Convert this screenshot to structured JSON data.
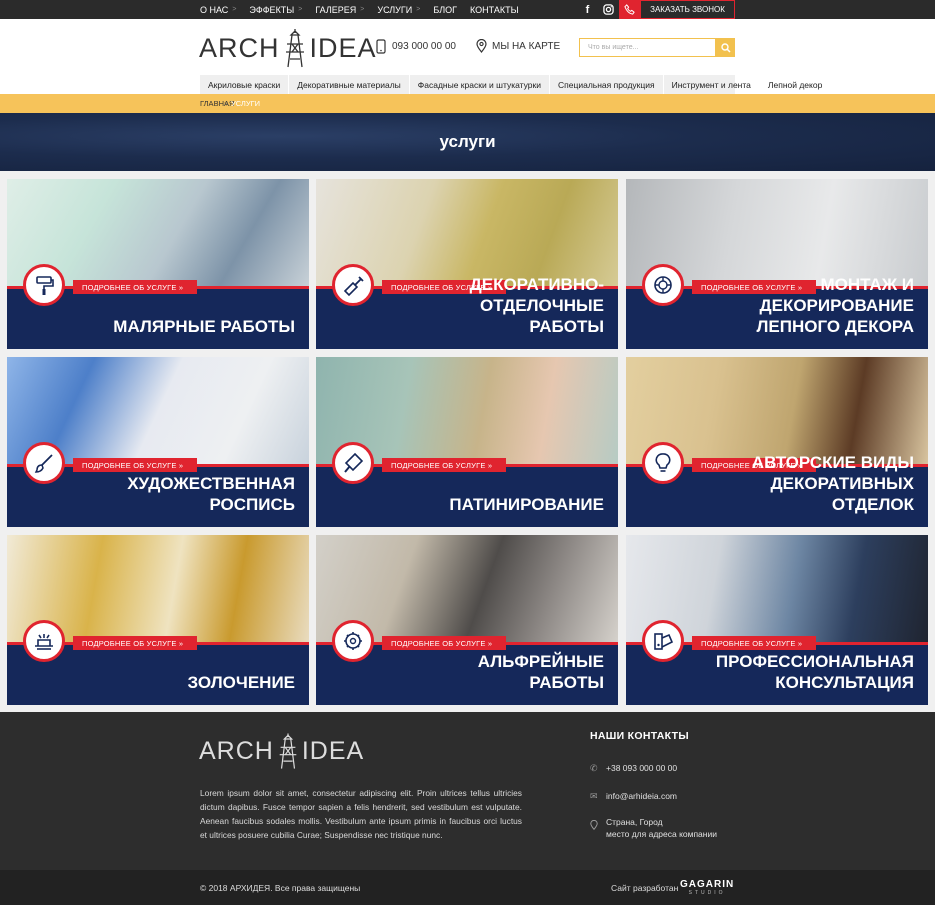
{
  "topbar": {
    "nav": [
      {
        "label": "О НАС",
        "has_sub": true
      },
      {
        "label": "ЭФФЕКТЫ",
        "has_sub": true
      },
      {
        "label": "ГАЛЕРЕЯ",
        "has_sub": true
      },
      {
        "label": "УСЛУГИ",
        "has_sub": true
      },
      {
        "label": "БЛОГ",
        "has_sub": false
      },
      {
        "label": "КОНТАКТЫ",
        "has_sub": false
      }
    ],
    "social": {
      "facebook": "f",
      "instagram": "instagram-icon",
      "phone": "phone-icon"
    },
    "call_button": "ЗАКАЗАТЬ ЗВОНОК"
  },
  "header": {
    "logo_left": "ARCH",
    "logo_right": "IDEA",
    "phone": "093 000 00 00",
    "map": "МЫ НА КАРТЕ",
    "search_placeholder": "Что вы ищете...",
    "categories": [
      "Акриловые краски",
      "Декоративные материалы",
      "Фасадные краски и штукатурки",
      "Специальная продукция",
      "Инструмент и лента",
      "Лепной декор"
    ]
  },
  "breadcrumb": {
    "home": "ГЛАВНАЯ",
    "separator": "»",
    "current": "УСЛУГИ"
  },
  "banner": {
    "title": "услуги"
  },
  "services": [
    {
      "title_lines": [
        "МАЛЯРНЫЕ РАБОТЫ"
      ],
      "more": "ПОДРОБНЕЕ ОБ УСЛУГЕ »",
      "icon": "paint-roller-icon"
    },
    {
      "title_lines": [
        "ДЕКОРАТИВНО-ОТДЕЛОЧНЫЕ",
        "РАБОТЫ"
      ],
      "more": "ПОДРОБНЕЕ ОБ УСЛУГЕ »",
      "icon": "trowel-icon"
    },
    {
      "title_lines": [
        "МОНТАЖ И ДЕКОРИРОВАНИЕ",
        "ЛЕПНОГО ДЕКОРА"
      ],
      "more": "ПОДРОБНЕЕ ОБ УСЛУГЕ »",
      "icon": "ornament-icon"
    },
    {
      "title_lines": [
        "ХУДОЖЕСТВЕННАЯ",
        "РОСПИСЬ"
      ],
      "more": "ПОДРОБНЕЕ ОБ УСЛУГЕ »",
      "icon": "brush-icon"
    },
    {
      "title_lines": [
        "ПАТИНИРОВАНИЕ"
      ],
      "more": "ПОДРОБНЕЕ ОБ УСЛУГЕ »",
      "icon": "paint-pot-icon"
    },
    {
      "title_lines": [
        "АВТОРСКИЕ ВИДЫ",
        "ДЕКОРАТИВНЫХ ОТДЕЛОК"
      ],
      "more": "ПОДРОБНЕЕ ОБ УСЛУГЕ »",
      "icon": "lightbulb-icon"
    },
    {
      "title_lines": [
        "ЗОЛОЧЕНИЕ"
      ],
      "more": "ПОДРОБНЕЕ ОБ УСЛУГЕ »",
      "icon": "gilding-icon"
    },
    {
      "title_lines": [
        "АЛЬФРЕЙНЫЕ",
        "РАБОТЫ"
      ],
      "more": "ПОДРОБНЕЕ ОБ УСЛУГЕ »",
      "icon": "gear-palette-icon"
    },
    {
      "title_lines": [
        "ПРОФЕССИОНАЛЬНАЯ",
        "КОНСУЛЬТАЦИЯ"
      ],
      "more": "ПОДРОБНЕЕ ОБ УСЛУГЕ »",
      "icon": "color-swatch-icon"
    }
  ],
  "footer": {
    "logo_left": "ARCH",
    "logo_right": "IDEA",
    "text": "Lorem ipsum dolor sit amet, consectetur adipiscing elit. Proin ultrices tellus ultricies dictum dapibus. Fusce tempor sapien a felis hendrerit, sed vestibulum est vulputate. Aenean faucibus sodales mollis. Vestibulum ante ipsum primis in faucibus orci luctus et ultrices posuere cubilia Curae; Suspendisse nec tristique nunc.",
    "contacts_title": "НАШИ КОНТАКТЫ",
    "phone": "+38 093 000 00 00",
    "email": "info@arhideia.com",
    "address_line1": "Страна, Город",
    "address_line2": "место для адреса компании",
    "copyright": "© 2018 АРХИДЕЯ. Все права защищены",
    "developed_by": "Сайт разработан",
    "studio": "GAGARIN",
    "studio_sub": "STUDIO"
  },
  "colors": {
    "accent_red": "#e0242f",
    "navy": "#15285a",
    "yellow": "#f6c35a",
    "dark": "#2d2d2d"
  }
}
